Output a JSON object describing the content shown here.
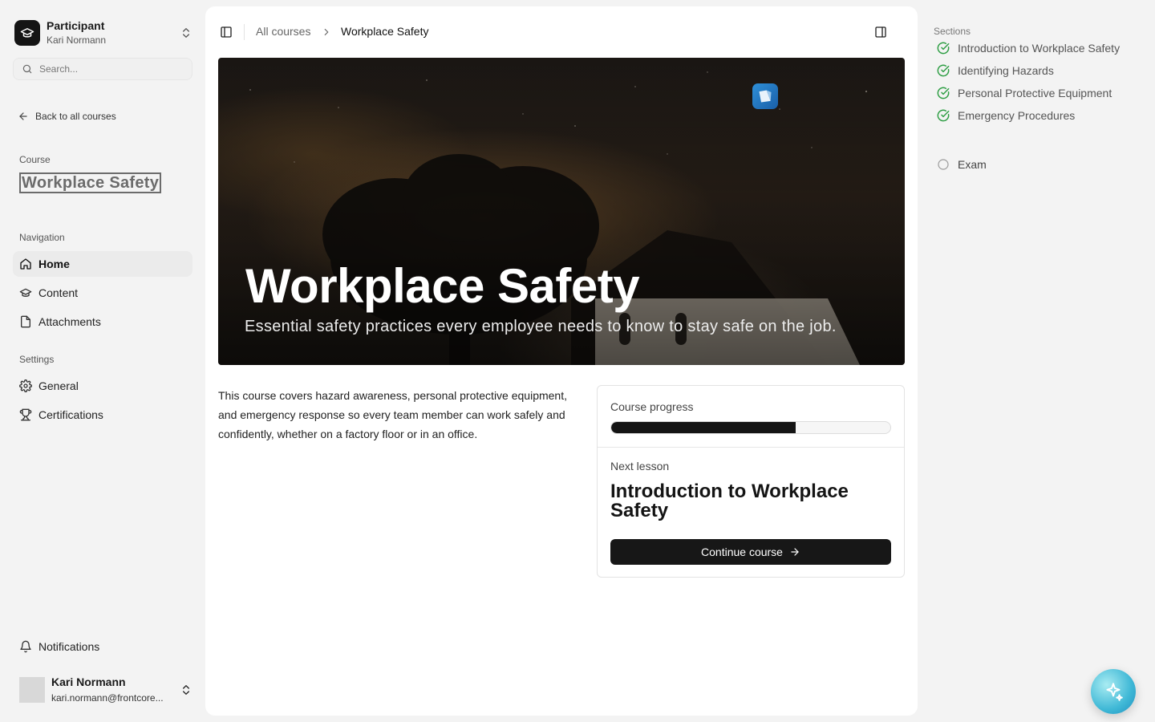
{
  "role": {
    "title": "Participant",
    "subtitle": "Kari Normann"
  },
  "search": {
    "placeholder": "Search..."
  },
  "back_link": "Back to all courses",
  "course": {
    "label": "Course",
    "title": "Workplace Safety"
  },
  "navigation": {
    "label": "Navigation",
    "items": [
      {
        "label": "Home",
        "icon": "home-icon",
        "active": true
      },
      {
        "label": "Content",
        "icon": "graduation-cap-icon"
      },
      {
        "label": "Attachments",
        "icon": "file-icon"
      }
    ]
  },
  "settings": {
    "label": "Settings",
    "items": [
      {
        "label": "General",
        "icon": "gear-icon"
      },
      {
        "label": "Certifications",
        "icon": "trophy-icon"
      }
    ]
  },
  "notifications": "Notifications",
  "user": {
    "name": "Kari Normann",
    "email": "kari.normann@frontcore..."
  },
  "breadcrumb": {
    "root": "All courses",
    "current": "Workplace Safety"
  },
  "hero": {
    "title": "Workplace Safety",
    "subtitle": "Essential safety practices every employee needs to know to stay safe on the job."
  },
  "description": "This course covers hazard awareness, personal protective equipment, and emergency response so every team member can work safely and confidently, whether on a factory floor or in an office.",
  "progress": {
    "label": "Course progress",
    "fraction": 0.66
  },
  "next_lesson": {
    "label": "Next lesson",
    "title": "Introduction to Workplace Safety",
    "button": "Continue course"
  },
  "sections": {
    "label": "Sections",
    "items": [
      {
        "label": "Introduction to Workplace Safety",
        "status": "complete"
      },
      {
        "label": "Identifying Hazards",
        "status": "complete"
      },
      {
        "label": "Personal Protective Equipment",
        "status": "complete"
      },
      {
        "label": "Emergency Procedures",
        "status": "complete"
      }
    ],
    "exam": {
      "label": "Exam",
      "status": "incomplete"
    }
  },
  "colors": {
    "accent": "#141414",
    "complete": "#2e9e44",
    "sidebar_bg": "#f3f3f3"
  }
}
